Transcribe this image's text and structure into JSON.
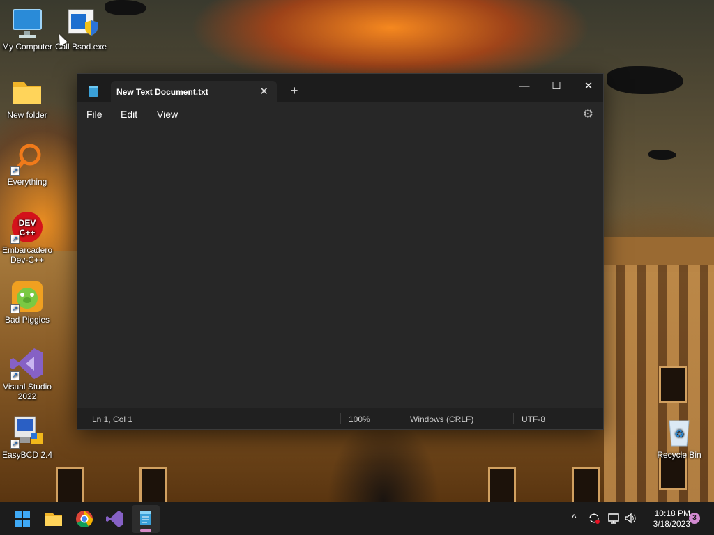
{
  "desktop": {
    "icons": [
      {
        "label": "My Computer",
        "icon": "monitor-icon"
      },
      {
        "label": "Call Bsod.exe",
        "icon": "shield-exe-icon"
      },
      {
        "label": "New folder",
        "icon": "folder-icon"
      },
      {
        "label": "Everything",
        "icon": "magnifier-icon"
      },
      {
        "label": "Embarcadero Dev-C++",
        "icon": "devcpp-icon"
      },
      {
        "label": "Bad Piggies",
        "icon": "pig-icon"
      },
      {
        "label": "Visual Studio 2022",
        "icon": "visual-studio-icon"
      },
      {
        "label": "EasyBCD 2.4",
        "icon": "easybcd-icon"
      },
      {
        "label": "Recycle Bin",
        "icon": "recycle-bin-icon"
      }
    ]
  },
  "notepad": {
    "tab_title": "New Text Document.txt",
    "tab_close": "✕",
    "new_tab": "+",
    "controls": {
      "minimize": "—",
      "maximize": "☐",
      "close": "✕"
    },
    "menu": {
      "file": "File",
      "edit": "Edit",
      "view": "View"
    },
    "settings_icon": "⚙",
    "content": "",
    "status": {
      "position": "Ln 1, Col 1",
      "zoom": "100%",
      "line_ending": "Windows (CRLF)",
      "encoding": "UTF-8"
    }
  },
  "taskbar": {
    "apps": [
      "start-icon",
      "file-explorer-icon",
      "chrome-icon",
      "visual-studio-icon",
      "notepad-icon"
    ],
    "tray": {
      "chevron": "^"
    },
    "clock": {
      "time": "10:18 PM",
      "date": "3/18/2023"
    },
    "notifications": "3"
  },
  "colors": {
    "accent": "#d58ac6",
    "window_bg": "#272727",
    "titlebar_bg": "#1c1c1c"
  }
}
